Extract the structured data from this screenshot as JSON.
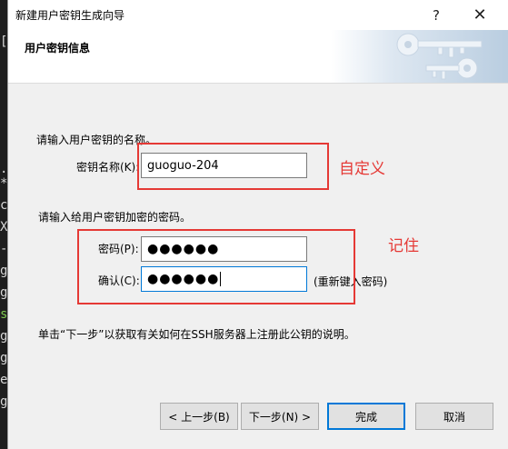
{
  "terminal_fragments": [
    "[",
    ".",
    "*",
    "c",
    "X",
    "-",
    "g",
    "g",
    "s",
    "g",
    "g",
    "e",
    "g"
  ],
  "window": {
    "title": "新建用户密钥生成向导",
    "help_glyph": "?",
    "close_glyph": "✕"
  },
  "header": {
    "title": "用户密钥信息"
  },
  "form": {
    "name_prompt": "请输入用户密钥的名称。",
    "name_label": "密钥名称(K):",
    "name_value": "guoguo-204",
    "password_prompt": "请输入给用户密钥加密的密码。",
    "password_label": "密码(P):",
    "password_value": "●●●●●●",
    "confirm_label": "确认(C):",
    "confirm_value": "●●●●●●",
    "confirm_hint": "(重新键入密码)",
    "info_text": "单击“下一步”以获取有关如何在SSH服务器上注册此公钥的说明。"
  },
  "annotations": {
    "name_note": "自定义",
    "password_note": "记住",
    "color": "#e53935"
  },
  "buttons": {
    "back": "< 上一步(B)",
    "next": "下一步(N) >",
    "finish": "完成",
    "cancel": "取消"
  },
  "colors": {
    "focus_border": "#0078d7"
  }
}
